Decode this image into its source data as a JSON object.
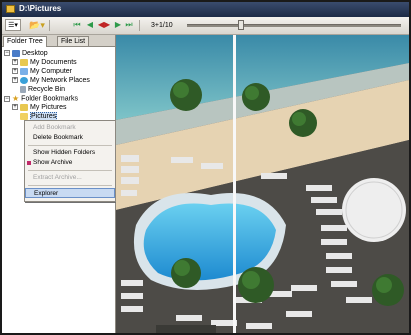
{
  "window": {
    "title": "D:\\Pictures"
  },
  "toolbar": {
    "counter": "3+1/10",
    "views_glyph": "☰▾",
    "folder_glyph": "📂▾",
    "nav": [
      "⏮",
      "◀",
      "◀▶",
      "▶",
      "⏭"
    ]
  },
  "tabs": {
    "tree": "Folder Tree",
    "list": "File List"
  },
  "tree": {
    "desktop": "Desktop",
    "my_documents": "My Documents",
    "my_computer": "My Computer",
    "my_network": "My Network Places",
    "recycle_bin": "Recycle Bin",
    "bookmarks": "Folder Bookmarks",
    "my_pictures": "My Pictures",
    "pictures": "Pictures"
  },
  "context_menu": {
    "add_bookmark": "Add Bookmark",
    "delete_bookmark": "Delete Bookmark",
    "show_hidden": "Show Hidden Folders",
    "show_archive": "Show Archive",
    "extract_archive": "Extract Archive...",
    "explorer": "Explorer"
  },
  "slider": {
    "position_fraction": 0.24
  }
}
